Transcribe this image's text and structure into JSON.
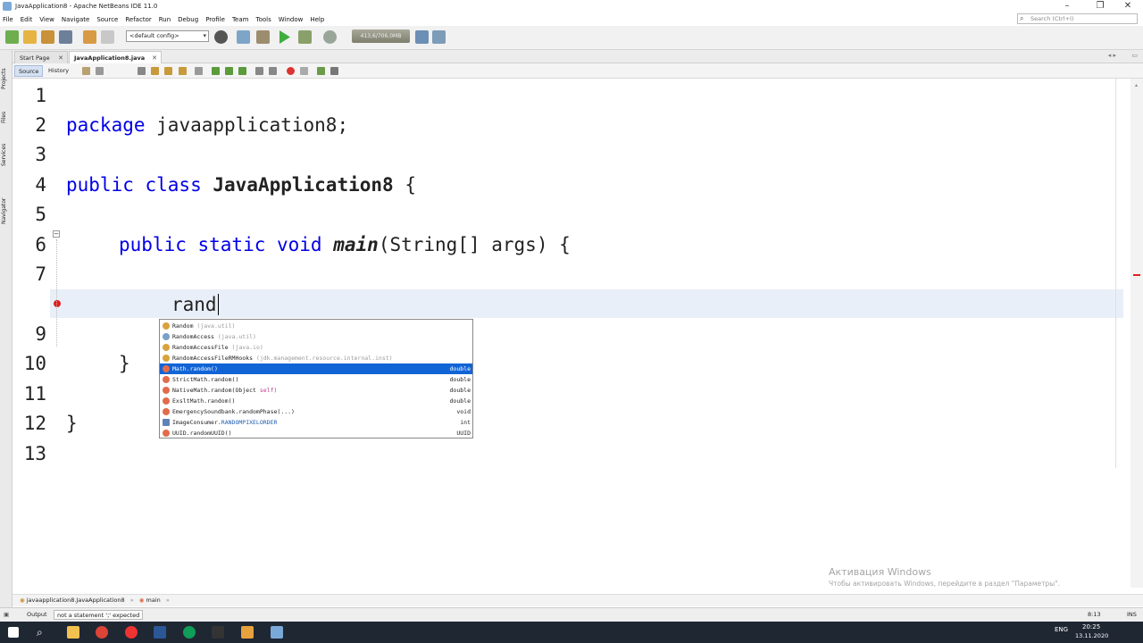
{
  "window": {
    "title": "JavaApplication8 - Apache NetBeans IDE 11.0",
    "minimize": "–",
    "restore": "❐",
    "close": "✕"
  },
  "menu": [
    "File",
    "Edit",
    "View",
    "Navigate",
    "Source",
    "Refactor",
    "Run",
    "Debug",
    "Profile",
    "Team",
    "Tools",
    "Window",
    "Help"
  ],
  "search": {
    "placeholder": "Search (Ctrl+I)"
  },
  "toolbar": {
    "config_value": "<default config>",
    "memory": "413,6/706,0MB"
  },
  "side_tabs": [
    "Projects",
    "Files",
    "Services",
    "Navigator"
  ],
  "editor_tabs": [
    {
      "label": "Start Page",
      "active": false
    },
    {
      "label": "JavaApplication8.java",
      "active": true
    }
  ],
  "editor_modes": {
    "source": "Source",
    "history": "History"
  },
  "line_numbers": [
    "1",
    "2",
    "3",
    "4",
    "5",
    "6",
    "7",
    "",
    "9",
    "10",
    "11",
    "12",
    "13"
  ],
  "code": {
    "l2": {
      "kw": "package",
      "rest": " javaapplication8;"
    },
    "l4": {
      "kw": "public class",
      "name": "JavaApplication8",
      "rest": " {"
    },
    "l6": {
      "kw": "public static void",
      "name": "main",
      "rest": "(String[] args) {"
    },
    "l8": "rand",
    "l10": "}",
    "l12": "}"
  },
  "completion": [
    {
      "name": "Random",
      "pkg": "(java.util)",
      "ret": "",
      "icon": "class",
      "selected": false
    },
    {
      "name": "RandomAccess",
      "pkg": "(java.util)",
      "ret": "",
      "icon": "interface",
      "selected": false
    },
    {
      "name": "RandomAccessFile",
      "pkg": "(java.io)",
      "ret": "",
      "icon": "class",
      "selected": false
    },
    {
      "name": "RandomAccessFileRMHooks",
      "pkg": "(jdk.management.resource.internal.inst)",
      "ret": "",
      "icon": "class",
      "selected": false
    },
    {
      "name": "Math.random()",
      "pkg": "",
      "ret": "double",
      "icon": "method",
      "selected": true
    },
    {
      "name": "StrictMath.random()",
      "pkg": "",
      "ret": "double",
      "icon": "method",
      "selected": false
    },
    {
      "name": "NativeMath.random(Object ",
      "pkg": "self)",
      "ret": "double",
      "icon": "method",
      "selected": false
    },
    {
      "name": "ExsltMath.random()",
      "pkg": "",
      "ret": "double",
      "icon": "method",
      "selected": false
    },
    {
      "name": "EmergencySoundbank.randomPhase(...)",
      "pkg": "",
      "ret": "void",
      "icon": "method",
      "selected": false
    },
    {
      "name": "ImageConsumer.RANDOMPIXELORDER",
      "pkg": "",
      "ret": "int",
      "icon": "field",
      "selected": false
    },
    {
      "name": "UUID.randomUUID()",
      "pkg": "",
      "ret": "UUID",
      "icon": "method",
      "selected": false
    }
  ],
  "watermark": {
    "line1": "Активация Windows",
    "line2": "Чтобы активировать Windows, перейдите в раздел \"Параметры\"."
  },
  "breadcrumb": {
    "class": "javaapplication8.JavaApplication8",
    "method": "main"
  },
  "status": {
    "output": "Output",
    "message": "not a statement ';' expected",
    "position": "8:13",
    "mode": "INS"
  },
  "taskbar": {
    "lang": "ENG",
    "time": "20:25",
    "date": "13.11.2020"
  },
  "colors": {
    "keyword": "#0000e6",
    "selection": "#1164d6",
    "current_line": "#e9eff8",
    "error": "#e02020"
  }
}
